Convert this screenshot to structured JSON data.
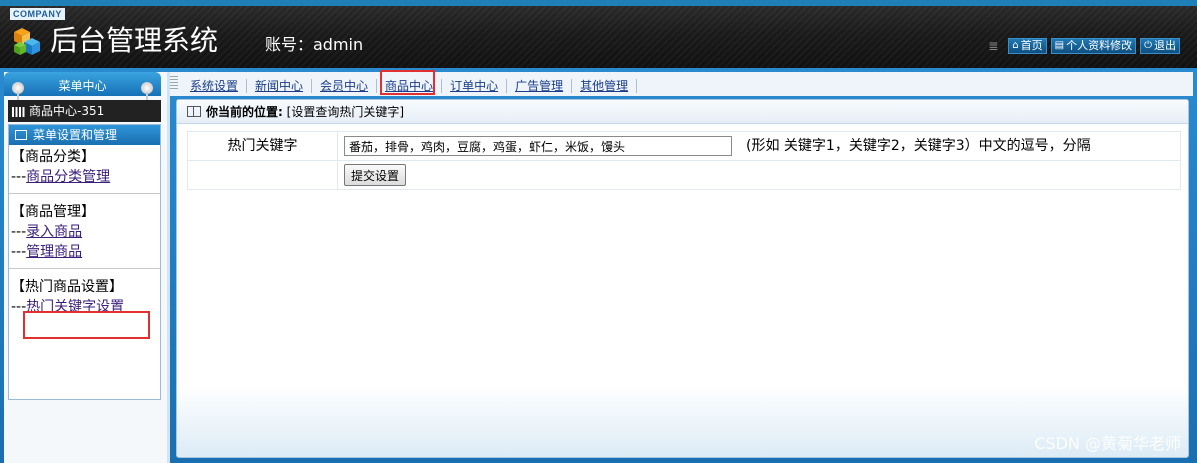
{
  "header": {
    "company": "COMPANY",
    "title": "后台管理系统",
    "account": "账号：admin",
    "links": [
      {
        "icon": "home-icon",
        "label": "首页"
      },
      {
        "icon": "profile-icon",
        "label": "个人资料修改"
      },
      {
        "icon": "power-icon",
        "label": "退出"
      }
    ]
  },
  "sidebar": {
    "title": "菜单中心",
    "module": "商品中心-351",
    "panel_title": "菜单设置和管理",
    "groups": [
      {
        "title": "【商品分类】",
        "items": [
          "商品分类管理"
        ]
      },
      {
        "title": "【商品管理】",
        "items": [
          "录入商品",
          "管理商品"
        ]
      },
      {
        "title": "【热门商品设置】",
        "items": [
          "热门关键字设置"
        ]
      }
    ],
    "item_prefix": "---"
  },
  "tabs": [
    "系统设置",
    "新闻中心",
    "会员中心",
    "商品中心",
    "订单中心",
    "广告管理",
    "其他管理"
  ],
  "breadcrumb": {
    "label": "你当前的位置:",
    "value": "[设置查询热门关键字]"
  },
  "form": {
    "label": "热门关键字",
    "keywords_value": "番茄，排骨，鸡肉，豆腐，鸡蛋，虾仁，米饭，馒头",
    "hint": "(形如 关键字1，关键字2，关键字3）中文的逗号，分隔",
    "submit_label": "提交设置"
  },
  "watermark": "CSDN @黄菊华老师",
  "colors": {
    "header_bg": "#1a1a1a",
    "frame_blue": "#1f7fb8",
    "highlight_red": "#e03030",
    "link_purple": "#3a1e7a"
  }
}
